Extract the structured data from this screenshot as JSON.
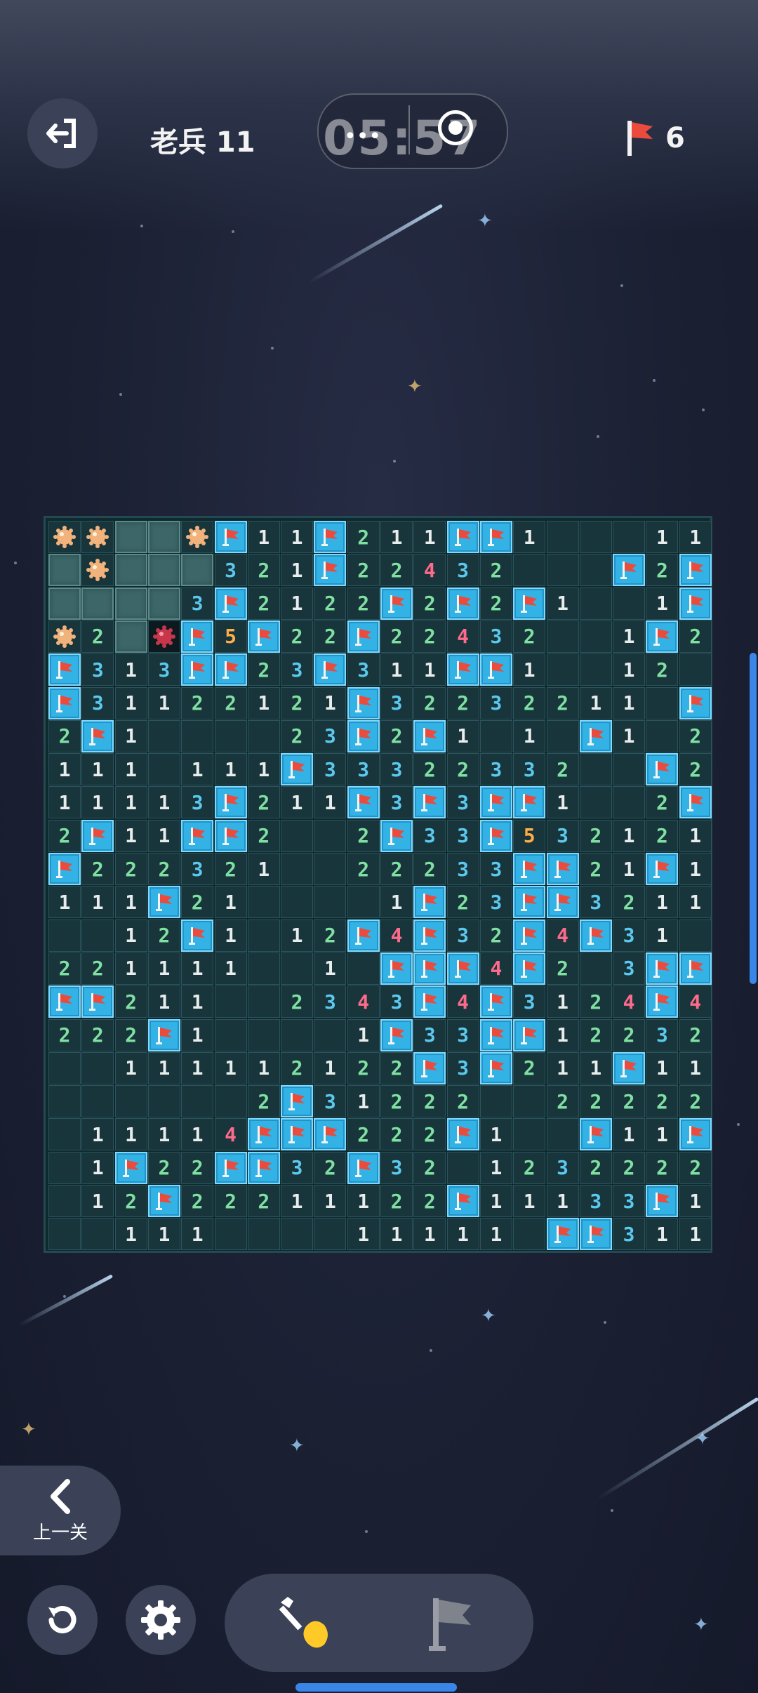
{
  "header": {
    "level_label": "老兵 11",
    "timer": "05:57",
    "capsule_dots": "•••",
    "flags_remaining": "6"
  },
  "board": {
    "cols": 20,
    "rows": 22,
    "legend": "F=flag, H=hidden, M=mine, X=exploded mine, 0=empty, digits=count",
    "rows_data": [
      "MMHHMF11F211FF100011",
      "HMHHH321F22432000F2F",
      "HHHH3F2122F2F2F1001FF",
      "M2HXF5F22F22432001F2",
      "F313FF23F311FF10012",
      "F31122121F322322110F1F",
      "2F1000023F2F1010F1020",
      "1110111F3332233200F2F",
      "11113F211F3F3FF1002F",
      "2F11FF2002F33F532121",
      "F2223210022233FF21F10",
      "111F2100001F23FF32110",
      "0012F1012F4F32F4F3100",
      "2211110010FFF4F203FF21",
      "FF211002343F4F3124F4F1",
      "222F100001F33FF12232",
      "00111112122F3F211F11F1",
      "0000002F3122200222222",
      "011114FFF222F100F11F1",
      "01F22FF32F32012322222",
      "012F22211122F11133F12F",
      "001110000111110FF3112F"
    ]
  },
  "controls": {
    "prev_level_label": "上一关"
  },
  "icons": {
    "exit": "exit-icon",
    "timer_pause": "pause-dots-icon",
    "record": "record-icon",
    "flag": "flag-icon",
    "back": "chevron-left-icon",
    "restart": "restart-icon",
    "settings": "gear-icon",
    "dig": "shovel-icon",
    "flag_mode": "gray-flag-icon"
  }
}
